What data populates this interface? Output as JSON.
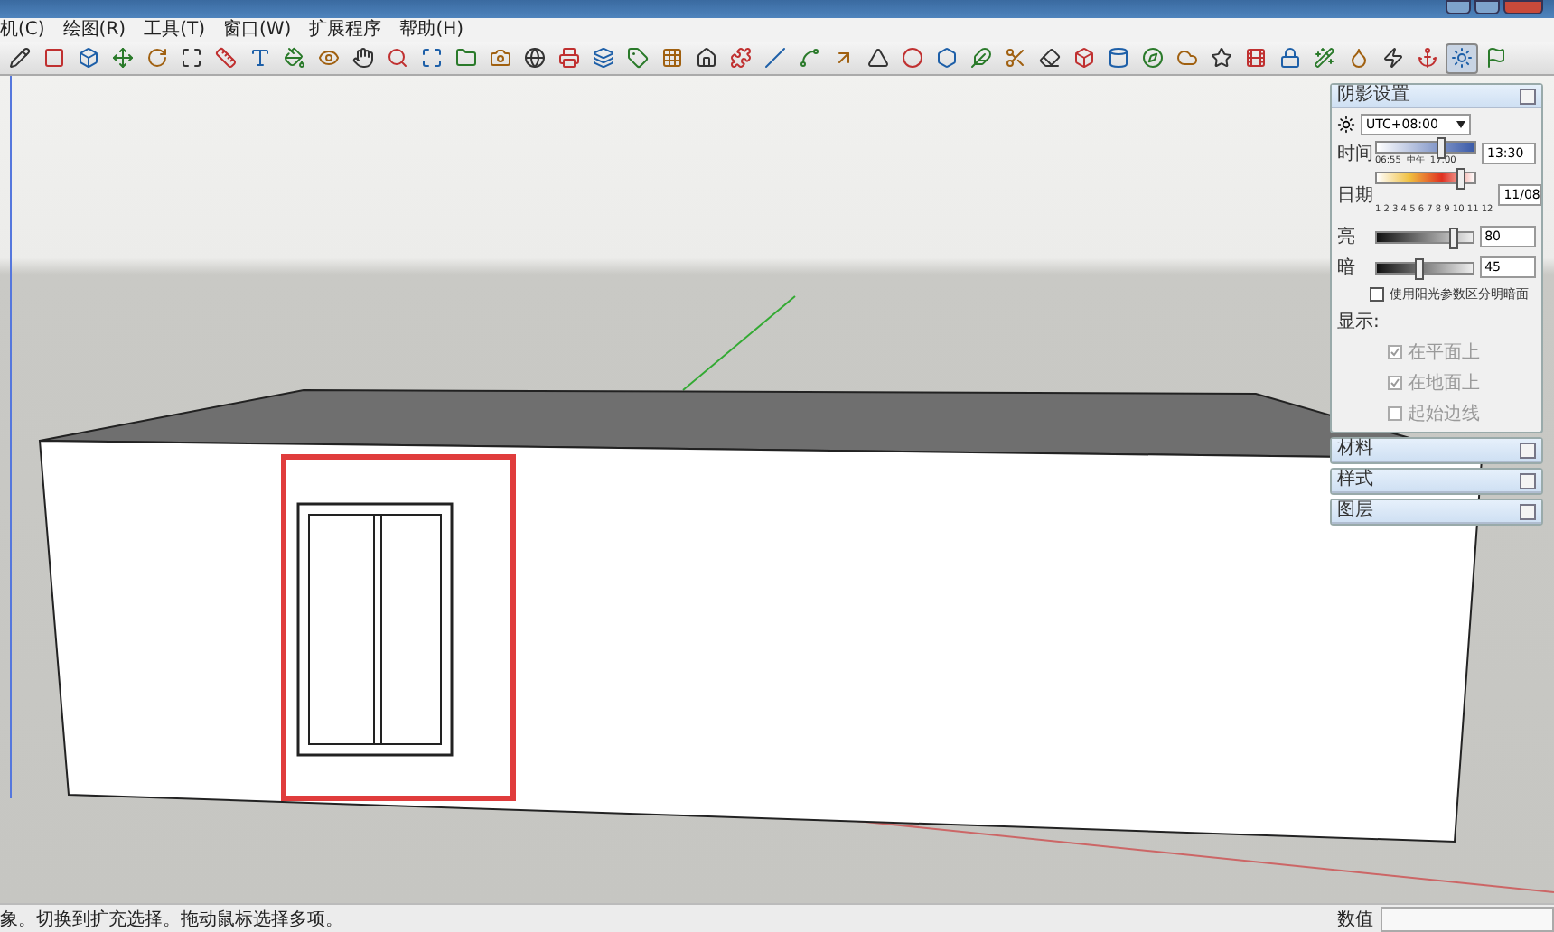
{
  "menu": [
    "机(C)",
    "绘图(R)",
    "工具(T)",
    "窗口(W)",
    "扩展程序",
    "帮助(H)"
  ],
  "toolbar_buttons": [
    {
      "selected": false
    },
    {
      "selected": false
    },
    {
      "selected": false
    },
    {
      "selected": false
    },
    {
      "selected": false
    },
    {
      "selected": false
    },
    {
      "selected": false
    },
    {
      "selected": false
    },
    {
      "selected": false
    },
    {
      "selected": false
    },
    {
      "selected": false
    },
    {
      "selected": false
    },
    {
      "selected": false
    },
    {
      "selected": false
    },
    {
      "selected": false
    },
    {
      "selected": false
    },
    {
      "selected": false
    },
    {
      "selected": false
    },
    {
      "selected": false
    },
    {
      "selected": false
    },
    {
      "selected": false
    },
    {
      "selected": false
    },
    {
      "selected": false
    },
    {
      "selected": false
    },
    {
      "selected": false
    },
    {
      "selected": false
    },
    {
      "selected": false
    },
    {
      "selected": false
    },
    {
      "selected": false
    },
    {
      "selected": false
    },
    {
      "selected": false
    },
    {
      "selected": false
    },
    {
      "selected": false
    },
    {
      "selected": false
    },
    {
      "selected": false
    },
    {
      "selected": false
    },
    {
      "selected": false
    },
    {
      "selected": false
    },
    {
      "selected": false
    },
    {
      "selected": false
    },
    {
      "selected": false
    },
    {
      "selected": false
    },
    {
      "selected": true
    },
    {
      "selected": false
    }
  ],
  "shadow_panel": {
    "title": "阴影设置",
    "timezone": "UTC+08:00",
    "time": {
      "label": "时间",
      "start": "06:55",
      "middle": "中午",
      "end": "17:00",
      "level": 0.65,
      "value": "13:30"
    },
    "date": {
      "label": "日期",
      "months": "1 2 3 4 5 6 7 8 9 10 11 12",
      "level": 0.86,
      "value": "11/08"
    },
    "light": {
      "label": "亮",
      "level": 0.8,
      "value": "80"
    },
    "dark": {
      "label": "暗",
      "level": 0.45,
      "value": "45"
    },
    "sun_option": {
      "label": "使用阳光参数区分明暗面",
      "checked": false
    },
    "display_label": "显示:",
    "display_options": [
      {
        "label": "在平面上",
        "checked": true,
        "disabled": true
      },
      {
        "label": "在地面上",
        "checked": true,
        "disabled": true
      },
      {
        "label": "起始边线",
        "checked": false,
        "disabled": true
      }
    ]
  },
  "collapsed_panels": [
    "材料",
    "样式",
    "图层"
  ],
  "status_bar": {
    "message": "象。切换到扩充选择。拖动鼠标选择多项。",
    "measurements_label": "数值"
  }
}
